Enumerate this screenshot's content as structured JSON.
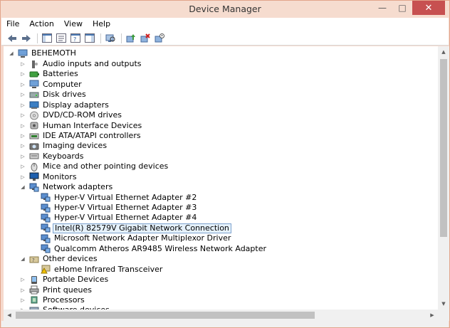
{
  "window": {
    "title": "Device Manager",
    "minimize_glyph": "—",
    "maximize_glyph": "□",
    "close_glyph": "✕"
  },
  "menu": [
    "File",
    "Action",
    "View",
    "Help"
  ],
  "toolbar_icons": [
    "back-arrow-icon",
    "forward-arrow-icon",
    "show-hide-console-tree-icon",
    "properties-icon",
    "help-icon",
    "show-hide-action-pane-icon",
    "scan-hardware-icon",
    "update-driver-icon",
    "uninstall-device-icon",
    "disable-device-icon"
  ],
  "tree": {
    "root": "BEHEMOTH",
    "items": [
      {
        "label": "Audio inputs and outputs",
        "icon": "audio-icon"
      },
      {
        "label": "Batteries",
        "icon": "battery-icon"
      },
      {
        "label": "Computer",
        "icon": "computer-icon"
      },
      {
        "label": "Disk drives",
        "icon": "disk-icon"
      },
      {
        "label": "Display adapters",
        "icon": "display-icon"
      },
      {
        "label": "DVD/CD-ROM drives",
        "icon": "dvd-icon"
      },
      {
        "label": "Human Interface Devices",
        "icon": "hid-icon"
      },
      {
        "label": "IDE ATA/ATAPI controllers",
        "icon": "ide-icon"
      },
      {
        "label": "Imaging devices",
        "icon": "camera-icon"
      },
      {
        "label": "Keyboards",
        "icon": "keyboard-icon"
      },
      {
        "label": "Mice and other pointing devices",
        "icon": "mouse-icon"
      },
      {
        "label": "Monitors",
        "icon": "monitor-icon"
      },
      {
        "label": "Network adapters",
        "icon": "network-icon"
      },
      {
        "label": "Hyper-V Virtual Ethernet Adapter #2",
        "icon": "network-icon"
      },
      {
        "label": "Hyper-V Virtual Ethernet Adapter #3",
        "icon": "network-icon"
      },
      {
        "label": "Hyper-V Virtual Ethernet Adapter #4",
        "icon": "network-icon"
      },
      {
        "label": "Intel(R) 82579V Gigabit Network Connection",
        "icon": "network-icon"
      },
      {
        "label": "Microsoft Network Adapter Multiplexor Driver",
        "icon": "network-icon"
      },
      {
        "label": "Qualcomm Atheros AR9485 Wireless Network Adapter",
        "icon": "network-icon"
      },
      {
        "label": "Other devices",
        "icon": "other-devices-icon"
      },
      {
        "label": "eHome Infrared Transceiver",
        "icon": "warning-device-icon"
      },
      {
        "label": "Portable Devices",
        "icon": "portable-icon"
      },
      {
        "label": "Print queues",
        "icon": "printer-icon"
      },
      {
        "label": "Processors",
        "icon": "processor-icon"
      },
      {
        "label": "Software devices",
        "icon": "software-icon"
      }
    ]
  },
  "colors": {
    "title_bar": "#f6dccf",
    "close_button": "#c75050",
    "selection_border": "#7da2ce",
    "selection_fill": "#e5f1fb"
  }
}
